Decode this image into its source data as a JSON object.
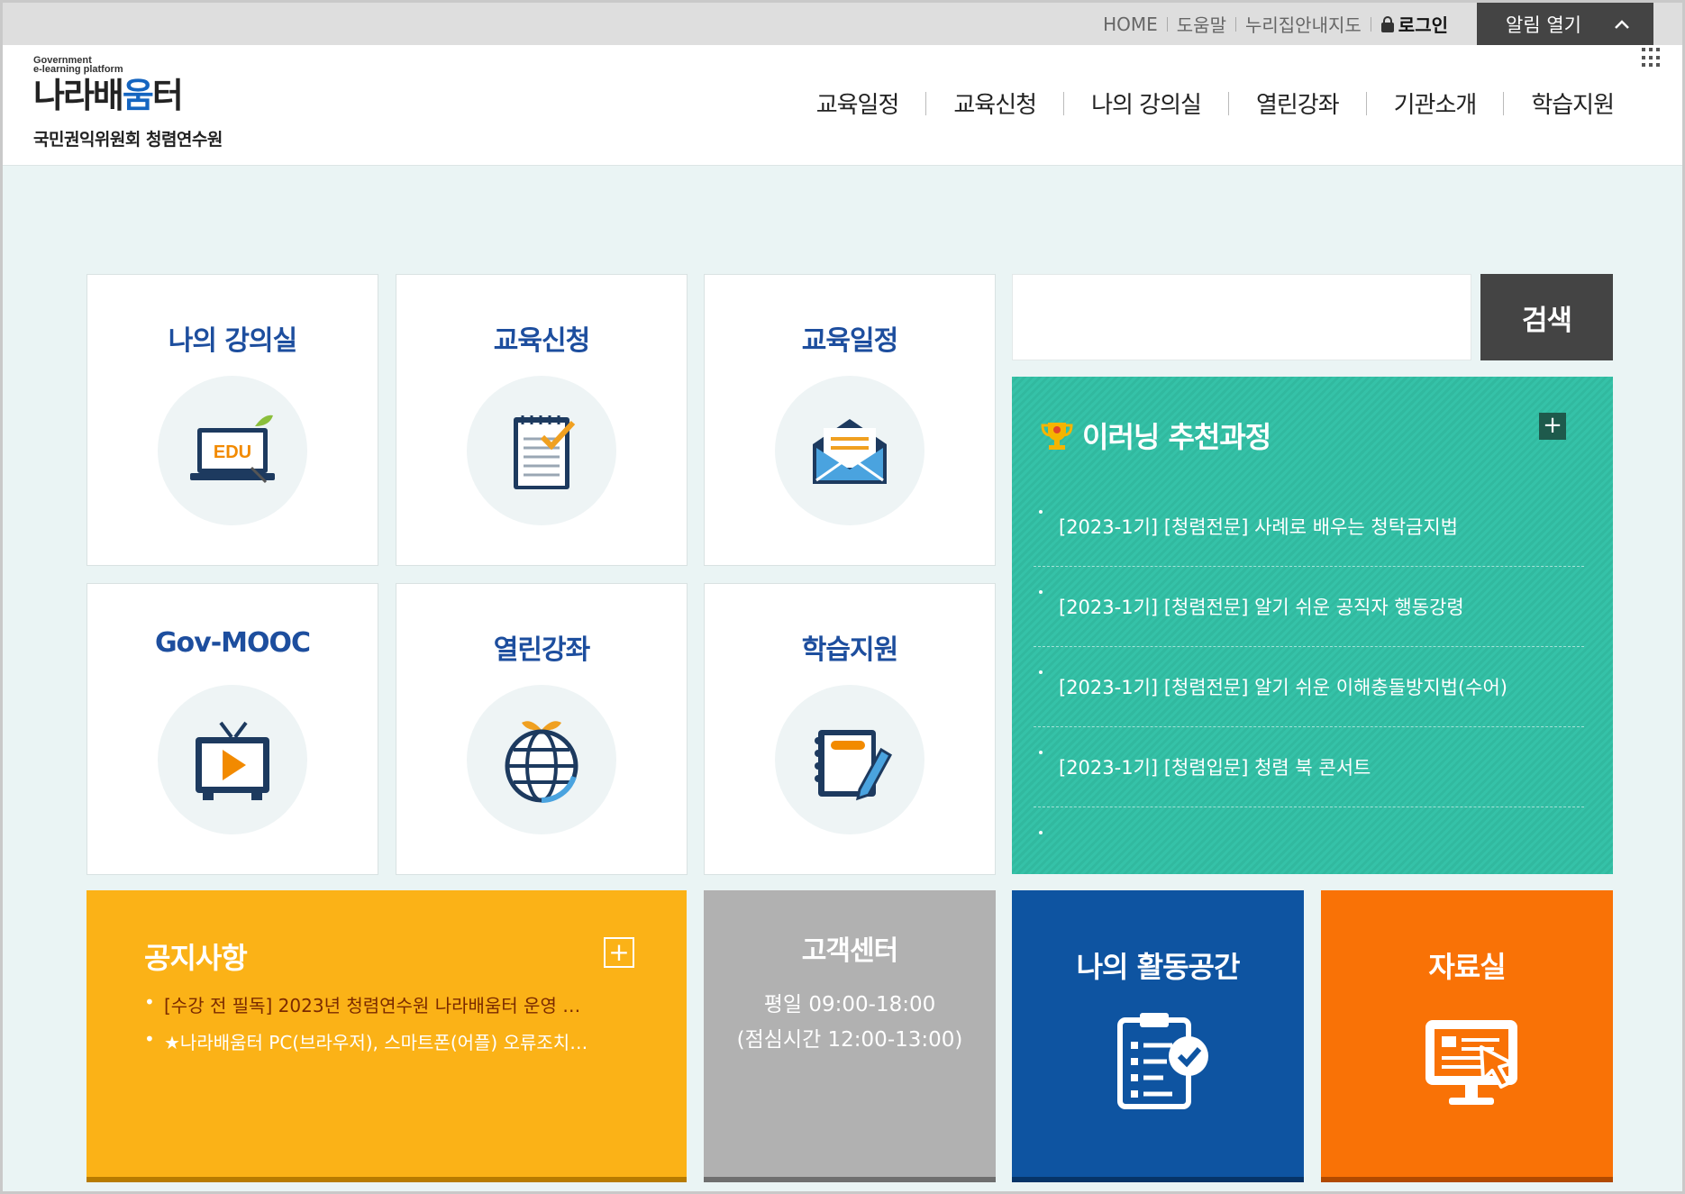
{
  "utility": {
    "home": "HOME",
    "help": "도움말",
    "sitemap": "누리집안내지도",
    "login": "로그인",
    "alarm": "알림 열기"
  },
  "header": {
    "logo_gov": "Government",
    "logo_platform": "e-learning platform",
    "logo_brand_a": "나라배",
    "logo_brand_b": "움",
    "logo_brand_c": "터",
    "org": "국민권익위원회 청렴연수원",
    "nav": [
      "교육일정",
      "교육신청",
      "나의 강의실",
      "열린강좌",
      "기관소개",
      "학습지원"
    ]
  },
  "tiles": {
    "my_class": "나의 강의실",
    "apply": "교육신청",
    "schedule": "교육일정",
    "mooc": "Gov-MOOC",
    "open_course": "열린강좌",
    "support": "학습지원",
    "edu_badge": "EDU"
  },
  "search": {
    "button": "검색",
    "placeholder": ""
  },
  "recommend": {
    "title": "이러닝 추천과정",
    "plus": "+",
    "items": [
      "[2023-1기] [청렴전문] 사례로 배우는 청탁금지법",
      "[2023-1기] [청렴전문] 알기 쉬운 공직자 행동강령",
      "[2023-1기] [청렴전문] 알기 쉬운 이해충돌방지법(수어)",
      "[2023-1기] [청렴입문] 청렴 북 콘서트"
    ]
  },
  "notice": {
    "title": "공지사항",
    "plus": "+",
    "items": [
      "[수강 전 필독] 2023년 청렴연수원 나라배움터 운영 …",
      "★나라배움터 PC(브라우저), 스마트폰(어플) 오류조치…"
    ]
  },
  "cs": {
    "title": "고객센터",
    "hours": "평일 09:00-18:00",
    "lunch": "(점심시간 12:00-13:00)"
  },
  "activity": {
    "title": "나의 활동공간"
  },
  "library": {
    "title": "자료실"
  },
  "colors": {
    "notice": "#fbb217",
    "cs": "#b1b1b1",
    "activity": "#0e54a1",
    "library": "#f97206",
    "recommend": "#34bfa5",
    "tile_title": "#1d4e9e"
  }
}
